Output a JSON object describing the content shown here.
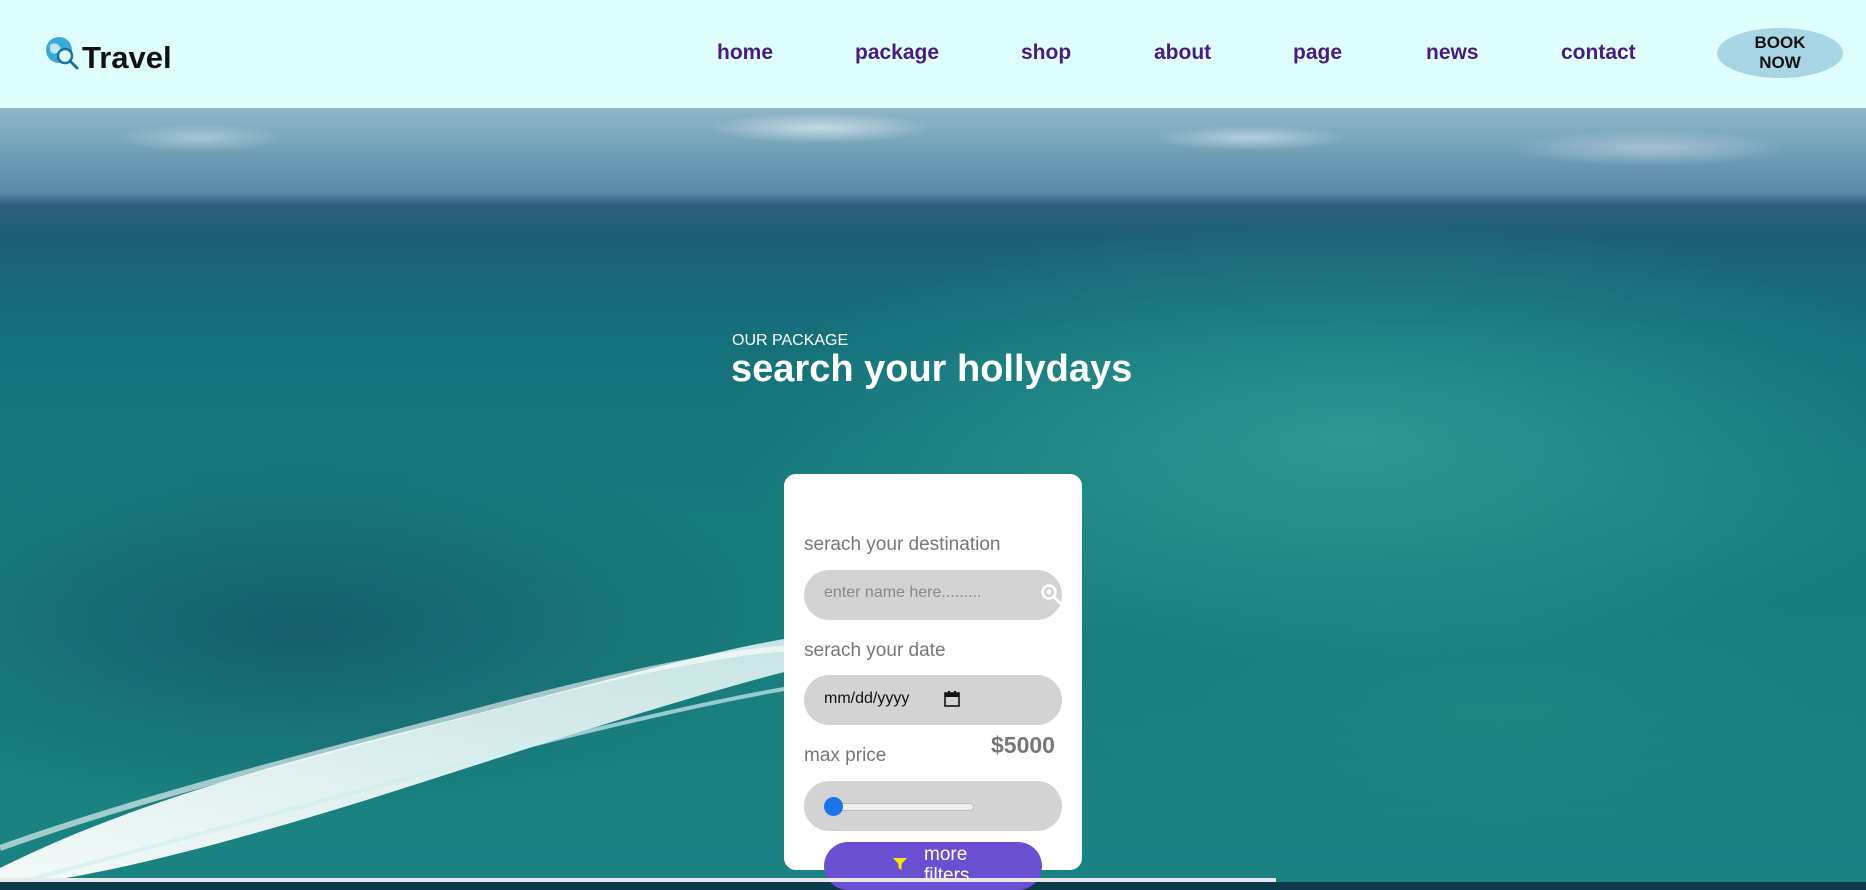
{
  "header": {
    "logo_text": "Travel",
    "logo_icon": "globe-search-icon",
    "nav": [
      "home",
      "package",
      "shop",
      "about",
      "page",
      "news",
      "contact"
    ],
    "book_label": "BOOK\nNOW"
  },
  "hero": {
    "kicker": "OUR PACKAGE",
    "headline": "search your hollydays"
  },
  "search_card": {
    "destination_label": "serach your destination",
    "destination_placeholder": "enter name here.........",
    "date_label": "serach your date",
    "date_value": "mm/dd/yyyy",
    "price_label": "max price",
    "price_value": "$5000",
    "slider_level": 0.0,
    "filters_label": "more\nfilters",
    "filters_icon": "filter-funnel-icon"
  },
  "colors": {
    "header_bg": "#dfffff",
    "nav_text": "#4a1c80",
    "book_bg": "#a9d6e4",
    "filters_bg": "#6a4fd0",
    "slider_accent": "#1a73e8"
  }
}
